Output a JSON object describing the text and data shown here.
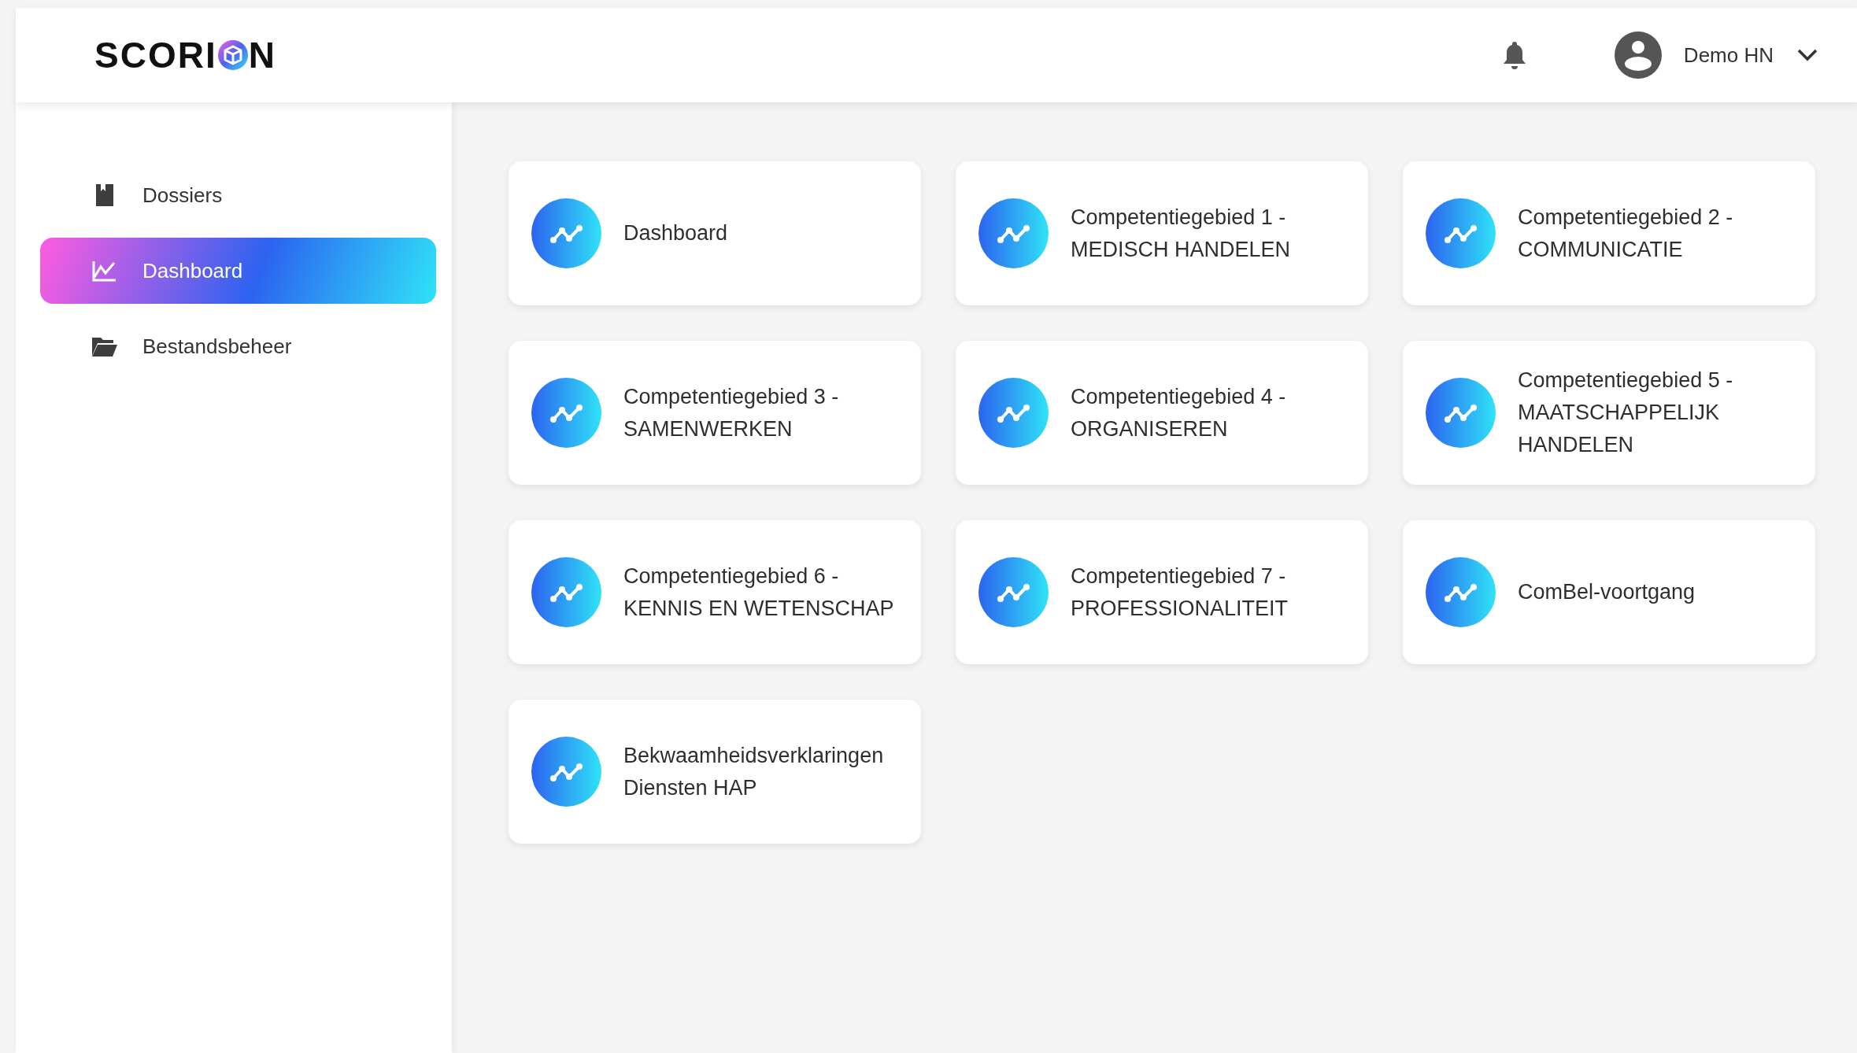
{
  "header": {
    "logo": {
      "text_before": "SCORI",
      "text_after": "N"
    },
    "user": {
      "name": "Demo HN"
    }
  },
  "sidebar": {
    "items": [
      {
        "label": "Dossiers",
        "selected": false
      },
      {
        "label": "Dashboard",
        "selected": true
      },
      {
        "label": "Bestandsbeheer",
        "selected": false
      }
    ]
  },
  "tiles": [
    {
      "title": "Dashboard"
    },
    {
      "title": "Competentiegebied 1 - MEDISCH HANDELEN"
    },
    {
      "title": "Competentiegebied 2 - COMMUNICATIE"
    },
    {
      "title": "Competentiegebied 3 - SAMENWERKEN"
    },
    {
      "title": "Competentiegebied 4 - ORGANISEREN"
    },
    {
      "title": "Competentiegebied 5 - MAATSCHAPPELIJK HANDELEN"
    },
    {
      "title": "Competentiegebied 6 - KENNIS EN WETENSCHAP"
    },
    {
      "title": "Competentiegebied 7 - PROFESSIONALITEIT"
    },
    {
      "title": "ComBel-voortgang"
    },
    {
      "title": "Bekwaamheidsverklaringen Diensten HAP"
    }
  ]
}
